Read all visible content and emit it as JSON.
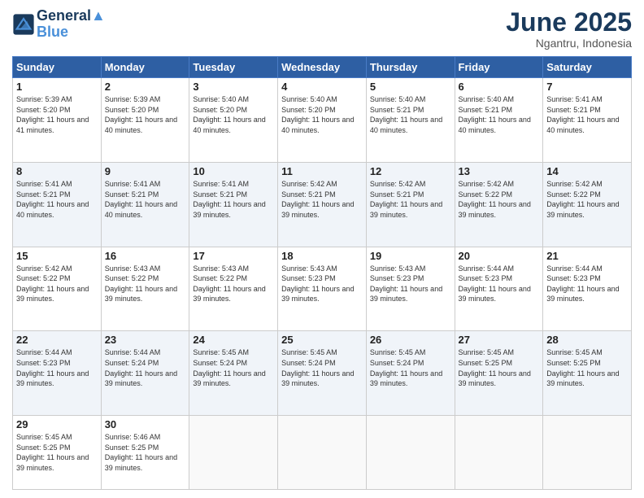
{
  "logo": {
    "line1": "General",
    "line2": "Blue"
  },
  "title": "June 2025",
  "location": "Ngantru, Indonesia",
  "days_header": [
    "Sunday",
    "Monday",
    "Tuesday",
    "Wednesday",
    "Thursday",
    "Friday",
    "Saturday"
  ],
  "weeks": [
    [
      {
        "day": "1",
        "sunrise": "5:39 AM",
        "sunset": "5:20 PM",
        "daylight": "11 hours and 41 minutes."
      },
      {
        "day": "2",
        "sunrise": "5:39 AM",
        "sunset": "5:20 PM",
        "daylight": "11 hours and 40 minutes."
      },
      {
        "day": "3",
        "sunrise": "5:40 AM",
        "sunset": "5:20 PM",
        "daylight": "11 hours and 40 minutes."
      },
      {
        "day": "4",
        "sunrise": "5:40 AM",
        "sunset": "5:20 PM",
        "daylight": "11 hours and 40 minutes."
      },
      {
        "day": "5",
        "sunrise": "5:40 AM",
        "sunset": "5:21 PM",
        "daylight": "11 hours and 40 minutes."
      },
      {
        "day": "6",
        "sunrise": "5:40 AM",
        "sunset": "5:21 PM",
        "daylight": "11 hours and 40 minutes."
      },
      {
        "day": "7",
        "sunrise": "5:41 AM",
        "sunset": "5:21 PM",
        "daylight": "11 hours and 40 minutes."
      }
    ],
    [
      {
        "day": "8",
        "sunrise": "5:41 AM",
        "sunset": "5:21 PM",
        "daylight": "11 hours and 40 minutes."
      },
      {
        "day": "9",
        "sunrise": "5:41 AM",
        "sunset": "5:21 PM",
        "daylight": "11 hours and 40 minutes."
      },
      {
        "day": "10",
        "sunrise": "5:41 AM",
        "sunset": "5:21 PM",
        "daylight": "11 hours and 39 minutes."
      },
      {
        "day": "11",
        "sunrise": "5:42 AM",
        "sunset": "5:21 PM",
        "daylight": "11 hours and 39 minutes."
      },
      {
        "day": "12",
        "sunrise": "5:42 AM",
        "sunset": "5:21 PM",
        "daylight": "11 hours and 39 minutes."
      },
      {
        "day": "13",
        "sunrise": "5:42 AM",
        "sunset": "5:22 PM",
        "daylight": "11 hours and 39 minutes."
      },
      {
        "day": "14",
        "sunrise": "5:42 AM",
        "sunset": "5:22 PM",
        "daylight": "11 hours and 39 minutes."
      }
    ],
    [
      {
        "day": "15",
        "sunrise": "5:42 AM",
        "sunset": "5:22 PM",
        "daylight": "11 hours and 39 minutes."
      },
      {
        "day": "16",
        "sunrise": "5:43 AM",
        "sunset": "5:22 PM",
        "daylight": "11 hours and 39 minutes."
      },
      {
        "day": "17",
        "sunrise": "5:43 AM",
        "sunset": "5:22 PM",
        "daylight": "11 hours and 39 minutes."
      },
      {
        "day": "18",
        "sunrise": "5:43 AM",
        "sunset": "5:23 PM",
        "daylight": "11 hours and 39 minutes."
      },
      {
        "day": "19",
        "sunrise": "5:43 AM",
        "sunset": "5:23 PM",
        "daylight": "11 hours and 39 minutes."
      },
      {
        "day": "20",
        "sunrise": "5:44 AM",
        "sunset": "5:23 PM",
        "daylight": "11 hours and 39 minutes."
      },
      {
        "day": "21",
        "sunrise": "5:44 AM",
        "sunset": "5:23 PM",
        "daylight": "11 hours and 39 minutes."
      }
    ],
    [
      {
        "day": "22",
        "sunrise": "5:44 AM",
        "sunset": "5:23 PM",
        "daylight": "11 hours and 39 minutes."
      },
      {
        "day": "23",
        "sunrise": "5:44 AM",
        "sunset": "5:24 PM",
        "daylight": "11 hours and 39 minutes."
      },
      {
        "day": "24",
        "sunrise": "5:45 AM",
        "sunset": "5:24 PM",
        "daylight": "11 hours and 39 minutes."
      },
      {
        "day": "25",
        "sunrise": "5:45 AM",
        "sunset": "5:24 PM",
        "daylight": "11 hours and 39 minutes."
      },
      {
        "day": "26",
        "sunrise": "5:45 AM",
        "sunset": "5:24 PM",
        "daylight": "11 hours and 39 minutes."
      },
      {
        "day": "27",
        "sunrise": "5:45 AM",
        "sunset": "5:25 PM",
        "daylight": "11 hours and 39 minutes."
      },
      {
        "day": "28",
        "sunrise": "5:45 AM",
        "sunset": "5:25 PM",
        "daylight": "11 hours and 39 minutes."
      }
    ],
    [
      {
        "day": "29",
        "sunrise": "5:45 AM",
        "sunset": "5:25 PM",
        "daylight": "11 hours and 39 minutes."
      },
      {
        "day": "30",
        "sunrise": "5:46 AM",
        "sunset": "5:25 PM",
        "daylight": "11 hours and 39 minutes."
      },
      null,
      null,
      null,
      null,
      null
    ]
  ]
}
